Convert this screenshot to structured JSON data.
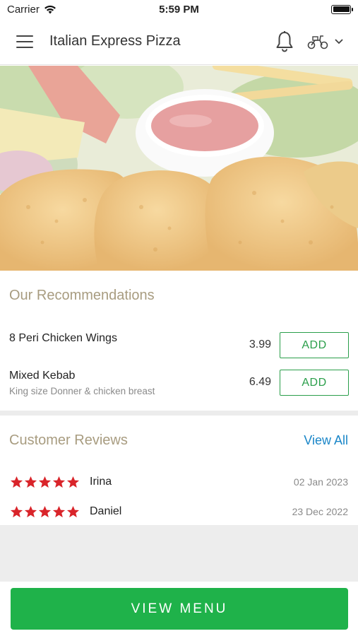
{
  "status_bar": {
    "carrier": "Carrier",
    "time": "5:59 PM"
  },
  "header": {
    "title": "Italian Express Pizza",
    "icons": [
      "menu-icon",
      "bell-icon",
      "scooter-icon",
      "chevron-down-icon"
    ]
  },
  "recommendations": {
    "title": "Our Recommendations",
    "items": [
      {
        "name": "8 Peri Chicken Wings",
        "description": "",
        "price": "3.99",
        "button": "ADD"
      },
      {
        "name": "Mixed Kebab",
        "description": "King size  Donner & chicken breast",
        "price": "6.49",
        "button": "ADD"
      }
    ]
  },
  "reviews": {
    "title": "Customer Reviews",
    "view_all": "View All",
    "items": [
      {
        "name": "Irina",
        "date": "02 Jan 2023",
        "rating": 5
      },
      {
        "name": "Daniel",
        "date": "23 Dec 2022",
        "rating": 5
      }
    ]
  },
  "footer": {
    "button": "VIEW MENU"
  },
  "colors": {
    "accent_green": "#1fb24a",
    "add_green": "#2a9e4a",
    "section_title": "#a89c80",
    "link_blue": "#1a86c8",
    "star_red": "#d9242a"
  }
}
